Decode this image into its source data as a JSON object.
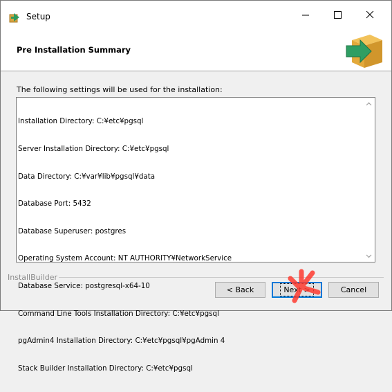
{
  "window": {
    "title": "Setup",
    "controls": {
      "minimize": "minimize",
      "maximize": "maximize",
      "close": "close"
    }
  },
  "header": {
    "title": "Pre Installation Summary",
    "logo_icon": "installer-box-arrow-icon"
  },
  "intro_text": "The following settings will be used for the installation:",
  "summary_lines": [
    "Installation Directory: C:¥etc¥pgsql",
    "Server Installation Directory: C:¥etc¥pgsql",
    "Data Directory: C:¥var¥lib¥pgsql¥data",
    "Database Port: 5432",
    "Database Superuser: postgres",
    "Operating System Account: NT AUTHORITY¥NetworkService",
    "Database Service: postgresql-x64-10",
    "Command Line Tools Installation Directory: C:¥etc¥pgsql",
    "pgAdmin4 Installation Directory: C:¥etc¥pgsql¥pgAdmin 4",
    "Stack Builder Installation Directory: C:¥etc¥pgsql"
  ],
  "footer": {
    "brand": "InstallBuilder"
  },
  "buttons": {
    "back": "< Back",
    "next": "Next >",
    "cancel": "Cancel"
  },
  "colors": {
    "focus_blue": "#0078d7",
    "click_marker": "#ff3b30"
  }
}
